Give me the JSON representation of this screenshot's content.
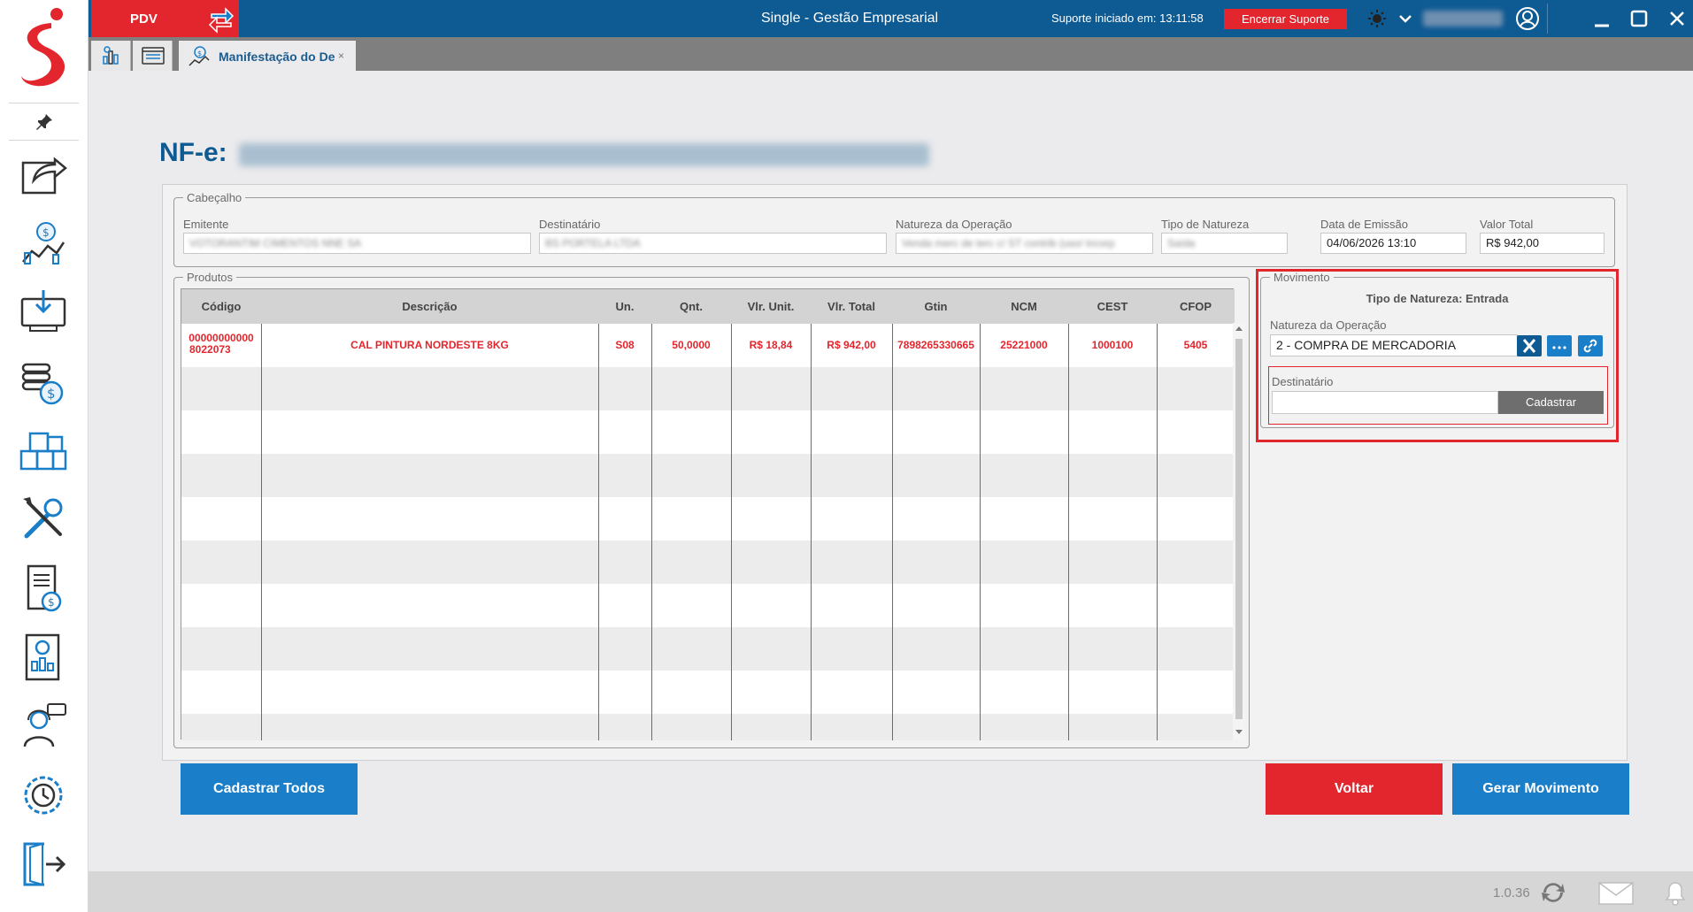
{
  "topbar": {
    "pdv_label": "PDV",
    "title": "Single - Gestão Empresarial",
    "support_status": "Suporte iniciado em: 13:11:58",
    "end_support_label": "Encerrar Suporte"
  },
  "tabs": {
    "active_label": "Manifestação do De",
    "close_glyph": "×"
  },
  "page": {
    "title": "NF-e:"
  },
  "cabecalho": {
    "legend": "Cabeçalho",
    "emitente_label": "Emitente",
    "emitente_value": "VOTORANTIM CIMENTOS NNE SA",
    "destinatario_label": "Destinatário",
    "destinatario_value": "BS PORTELA LTDA",
    "natureza_label": "Natureza da Operação",
    "natureza_value": "Venda merc de terc c/ ST contrib (uso/ incorp",
    "tipo_label": "Tipo de Natureza",
    "tipo_value": "Saída",
    "data_label": "Data de Emissão",
    "data_value": "04/06/2026 13:10",
    "valor_label": "Valor Total",
    "valor_value": "R$ 942,00"
  },
  "produtos": {
    "legend": "Produtos",
    "columns": [
      "Código",
      "Descrição",
      "Un.",
      "Qnt.",
      "Vlr. Unit.",
      "Vlr. Total",
      "Gtin",
      "NCM",
      "CEST",
      "CFOP"
    ],
    "row": {
      "codigo_line1": "00000000000",
      "codigo_line2": "8022073",
      "descricao": "CAL PINTURA NORDESTE 8KG",
      "un": "S08",
      "qnt": "50,0000",
      "vlr_unit": "R$ 18,84",
      "vlr_total": "R$ 942,00",
      "gtin": "7898265330665",
      "ncm": "25221000",
      "cest": "1000100",
      "cfop": "5405"
    }
  },
  "movimento": {
    "legend": "Movimento",
    "tipo_natureza": "Tipo de Natureza: Entrada",
    "natureza_label": "Natureza da Operação",
    "natureza_value": "2 - COMPRA DE MERCADORIA",
    "destinatario_label": "Destinatário",
    "destinatario_value": "",
    "cadastrar_label": "Cadastrar"
  },
  "actions": {
    "cadastrar_todos": "Cadastrar Todos",
    "voltar": "Voltar",
    "gerar_movimento": "Gerar Movimento"
  },
  "status": {
    "version": "1.0.36"
  },
  "colors": {
    "brand_red": "#e3262e",
    "brand_blue": "#0e5a93",
    "button_blue": "#1a7ec8"
  }
}
